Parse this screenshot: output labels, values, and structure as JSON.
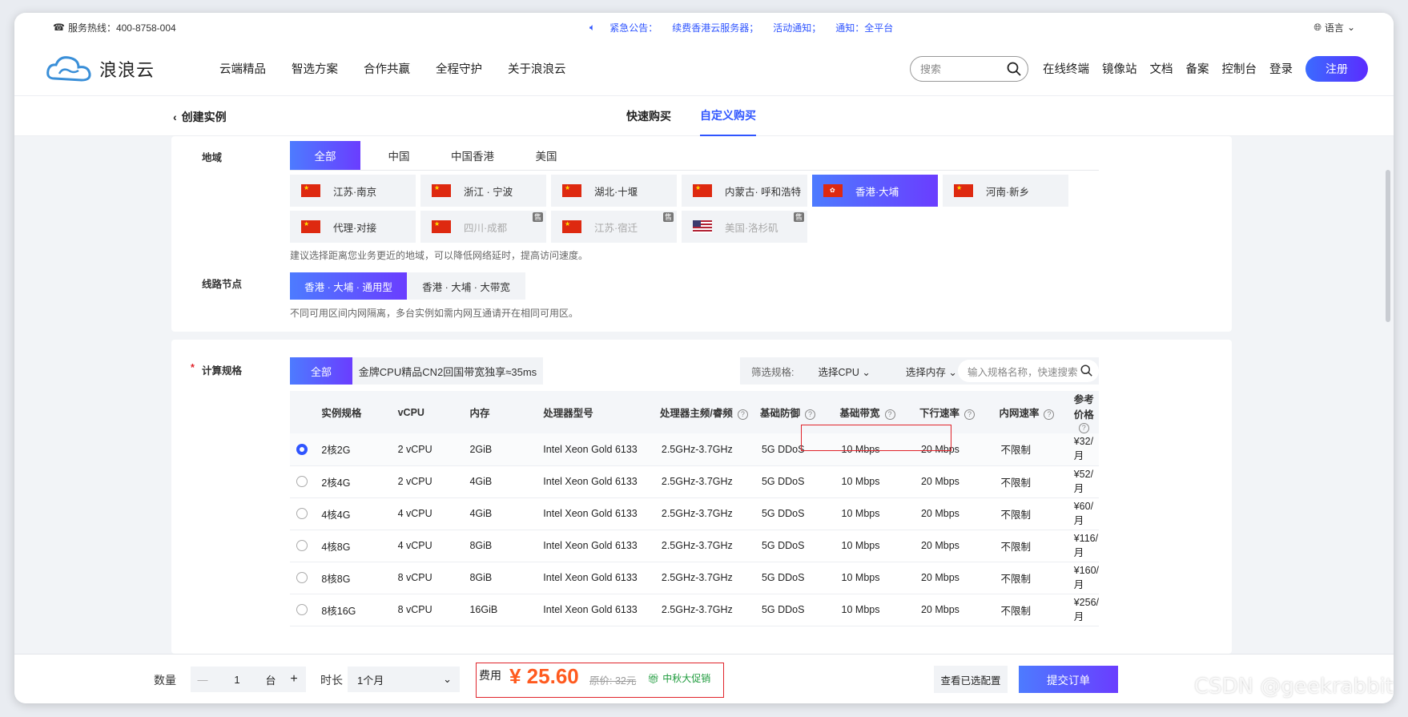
{
  "topbar": {
    "hotline": "服务热线：400-8758-004",
    "notice_label": "紧急公告：",
    "notice_text": "续费香港云服务器；",
    "activity": "活动通知；",
    "notice2": "通知：全平台",
    "language": "语言"
  },
  "header": {
    "logo": "浪浪云",
    "nav": [
      "云端精品",
      "智选方案",
      "合作共赢",
      "全程守护",
      "关于浪浪云"
    ],
    "search_placeholder": "搜索",
    "links": [
      "在线终端",
      "镜像站",
      "文档",
      "备案",
      "控制台",
      "登录"
    ],
    "register": "注册"
  },
  "subheader": {
    "back": "创建实例",
    "tabs": [
      "快速购买",
      "自定义购买"
    ],
    "active_tab": "自定义购买"
  },
  "region": {
    "label": "地域",
    "tabs": [
      "全部",
      "中国",
      "中国香港",
      "美国"
    ],
    "cities": [
      {
        "name": "江苏·南京",
        "flag": "cn",
        "state": "normal"
      },
      {
        "name": "浙江 · 宁波",
        "flag": "cn",
        "state": "normal"
      },
      {
        "name": "湖北·十堰",
        "flag": "cn",
        "state": "normal"
      },
      {
        "name": "内蒙古· 呼和浩特",
        "flag": "cn",
        "state": "normal"
      },
      {
        "name": "香港·大埔",
        "flag": "hk",
        "state": "active"
      },
      {
        "name": "河南·新乡",
        "flag": "cn",
        "state": "normal"
      },
      {
        "name": "代理·对接",
        "flag": "cn",
        "state": "normal"
      },
      {
        "name": "四川·成都",
        "flag": "cn",
        "state": "disabled"
      },
      {
        "name": "江苏·宿迁",
        "flag": "cn",
        "state": "disabled"
      },
      {
        "name": "美国·洛杉矶",
        "flag": "us",
        "state": "disabled"
      }
    ],
    "sold_badge": "售",
    "hint": "建议选择距离您业务更近的地域，可以降低网络延时，提高访问速度。"
  },
  "line": {
    "label": "线路节点",
    "nodes": [
      "香港 · 大埔 · 通用型",
      "香港 · 大埔 · 大带宽"
    ],
    "hint": "不同可用区间内网隔离，多台实例如需内网互通请开在相同可用区。"
  },
  "spec": {
    "required_mark": "*",
    "label": "计算规格",
    "tabs": [
      "全部",
      "金牌CPU精品CN2回国带宽独享≈35ms"
    ],
    "filter_label": "筛选规格:",
    "cpu_select": "选择CPU",
    "mem_select": "选择内存",
    "search_placeholder": "输入规格名称，快速搜索",
    "columns": [
      "实例规格",
      "vCPU",
      "内存",
      "处理器型号",
      "处理器主频/睿频",
      "基础防御",
      "基础带宽",
      "下行速率",
      "内网速率",
      "参考价格"
    ],
    "rows": [
      {
        "name": "2核2G",
        "vcpu": "2 vCPU",
        "mem": "2GiB",
        "cpu": "Intel Xeon Gold 6133",
        "freq": "2.5GHz-3.7GHz",
        "ddos": "5G DDoS",
        "bw": "10 Mbps",
        "down": "20 Mbps",
        "lan": "不限制",
        "price": "¥32/月",
        "selected": true
      },
      {
        "name": "2核4G",
        "vcpu": "2 vCPU",
        "mem": "4GiB",
        "cpu": "Intel Xeon Gold 6133",
        "freq": "2.5GHz-3.7GHz",
        "ddos": "5G DDoS",
        "bw": "10 Mbps",
        "down": "20 Mbps",
        "lan": "不限制",
        "price": "¥52/月",
        "selected": false
      },
      {
        "name": "4核4G",
        "vcpu": "4 vCPU",
        "mem": "4GiB",
        "cpu": "Intel Xeon Gold 6133",
        "freq": "2.5GHz-3.7GHz",
        "ddos": "5G DDoS",
        "bw": "10 Mbps",
        "down": "20 Mbps",
        "lan": "不限制",
        "price": "¥60/月",
        "selected": false
      },
      {
        "name": "4核8G",
        "vcpu": "4 vCPU",
        "mem": "8GiB",
        "cpu": "Intel Xeon Gold 6133",
        "freq": "2.5GHz-3.7GHz",
        "ddos": "5G DDoS",
        "bw": "10 Mbps",
        "down": "20 Mbps",
        "lan": "不限制",
        "price": "¥116/月",
        "selected": false
      },
      {
        "name": "8核8G",
        "vcpu": "8 vCPU",
        "mem": "8GiB",
        "cpu": "Intel Xeon Gold 6133",
        "freq": "2.5GHz-3.7GHz",
        "ddos": "5G DDoS",
        "bw": "10 Mbps",
        "down": "20 Mbps",
        "lan": "不限制",
        "price": "¥160/月",
        "selected": false
      },
      {
        "name": "8核16G",
        "vcpu": "8 vCPU",
        "mem": "16GiB",
        "cpu": "Intel Xeon Gold 6133",
        "freq": "2.5GHz-3.7GHz",
        "ddos": "5G DDoS",
        "bw": "10 Mbps",
        "down": "20 Mbps",
        "lan": "不限制",
        "price": "¥256/月",
        "selected": false
      }
    ]
  },
  "bottom": {
    "qty_label": "数量",
    "qty_minus": "—",
    "qty_value": "1",
    "qty_unit": "台",
    "qty_plus": "+",
    "duration_label": "时长",
    "duration_value": "1个月",
    "fee_label": "费用",
    "fee_value": "¥ 25.60",
    "original_price": "原价: 32元",
    "promo": "中秋大促销",
    "view_config": "查看已选配置",
    "submit": "提交订单"
  },
  "watermark": "CSDN @geekrabbit",
  "colors": {
    "accent": "#2f55ff",
    "price": "#ff5a1f",
    "highlight_box": "#e0242b",
    "promo": "#1c9a3b"
  }
}
